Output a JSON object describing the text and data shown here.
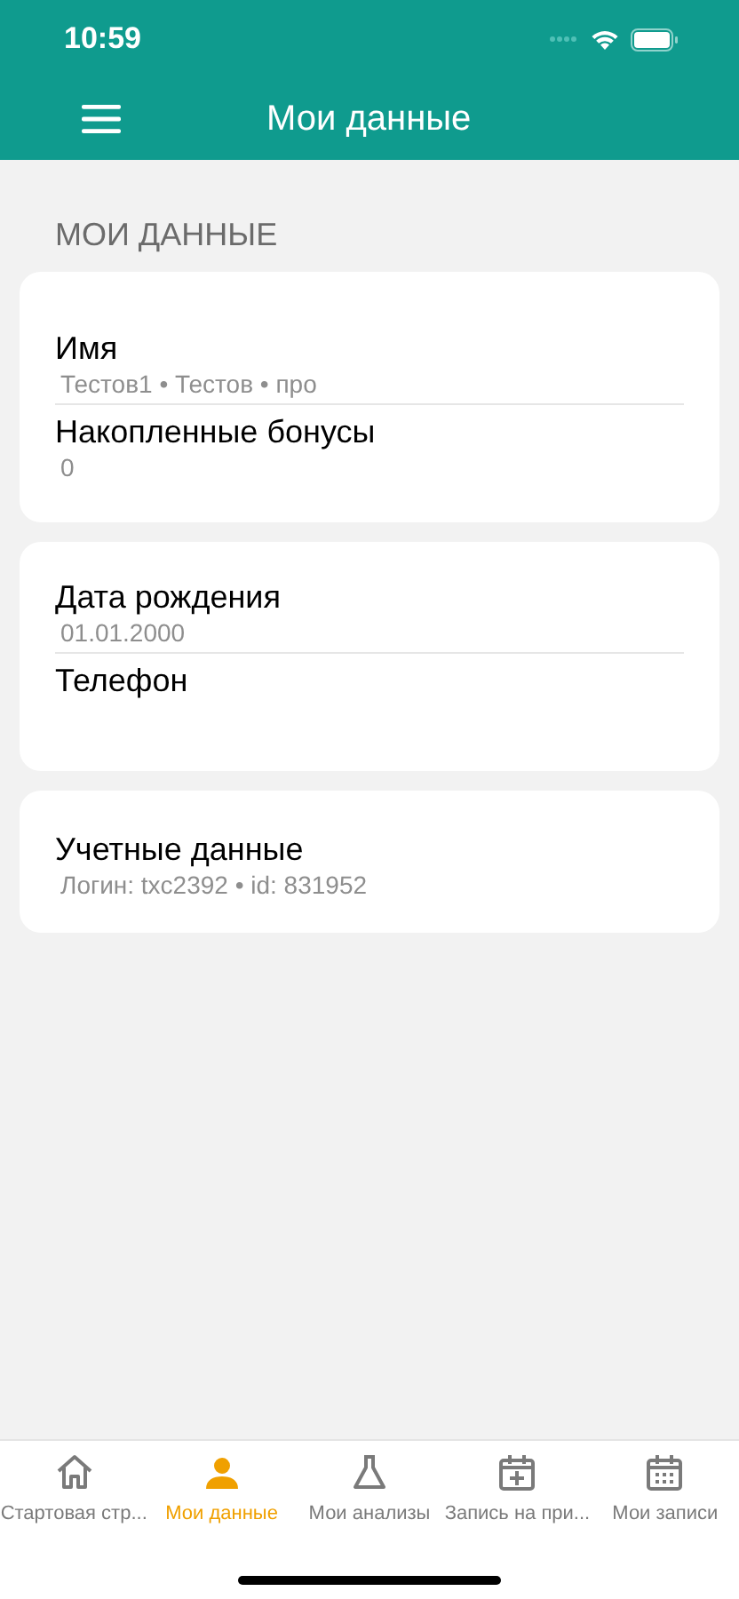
{
  "status_bar": {
    "time": "10:59"
  },
  "nav_bar": {
    "title": "Мои данные"
  },
  "section_header": "МОИ ДАННЫЕ",
  "cards": [
    {
      "rows": [
        {
          "label": "Имя",
          "value": "Тестов1 • Тестов • про"
        },
        {
          "label": "Накопленные бонусы",
          "value": "0"
        }
      ]
    },
    {
      "rows": [
        {
          "label": "Дата рождения",
          "value": "01.01.2000"
        },
        {
          "label": "Телефон"
        }
      ]
    },
    {
      "rows": [
        {
          "label": "Учетные данные",
          "value": "Логин: txc2392 • id: 831952"
        }
      ]
    }
  ],
  "tab_bar": [
    {
      "label": "Стартовая стр...",
      "selected": false
    },
    {
      "label": "Мои данные",
      "selected": true
    },
    {
      "label": "Мои анализы",
      "selected": false
    },
    {
      "label": "Запись на при...",
      "selected": false
    },
    {
      "label": "Мои записи",
      "selected": false
    }
  ]
}
